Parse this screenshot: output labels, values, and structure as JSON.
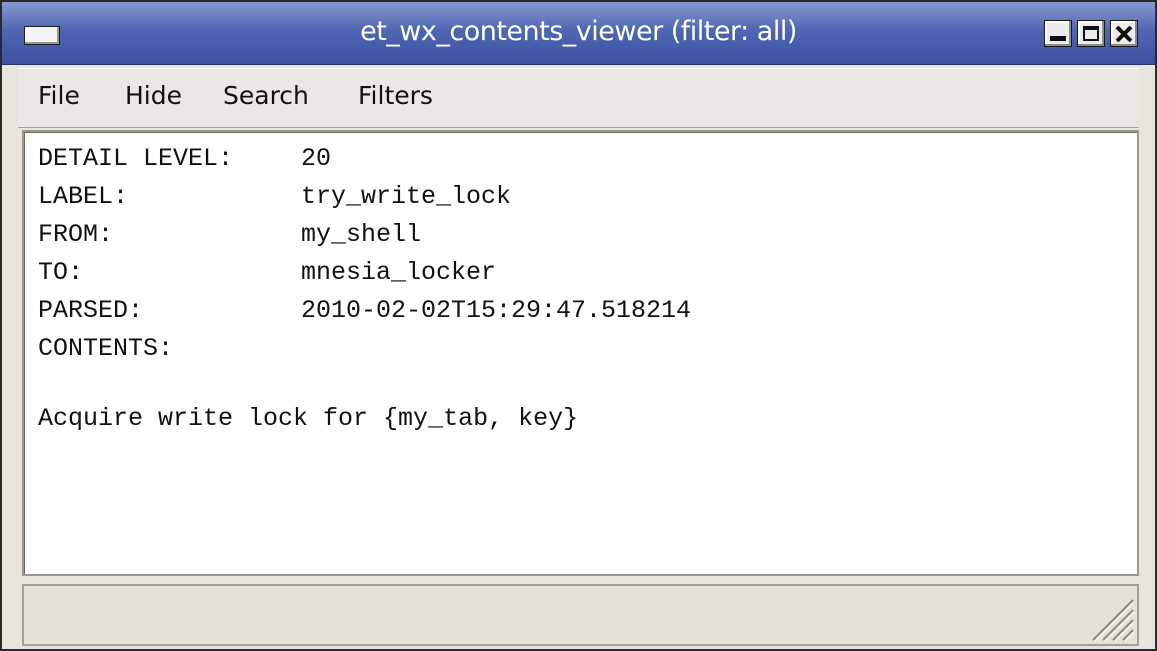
{
  "window": {
    "title": "et_wx_contents_viewer (filter: all)"
  },
  "menu": {
    "file": "File",
    "hide": "Hide",
    "search": "Search",
    "filters": "Filters"
  },
  "content": {
    "detail_level_label": "DETAIL LEVEL:",
    "detail_level_value": "20",
    "label_label": "LABEL:",
    "label_value": "try_write_lock",
    "from_label": "FROM:",
    "from_value": "my_shell",
    "to_label": "TO:",
    "to_value": "mnesia_locker",
    "parsed_label": "PARSED:",
    "parsed_value": "2010-02-02T15:29:47.518214",
    "contents_label": "CONTENTS:",
    "body_text": "Acquire write lock for {my_tab, key}"
  },
  "status": {
    "text": ""
  },
  "icons": {
    "window_menu": "window-menu-icon",
    "minimize": "minimize-icon",
    "maximize": "maximize-icon",
    "close": "close-icon",
    "resize_grip": "resize-grip-icon"
  },
  "colors": {
    "titlebar": "#4e66b3",
    "window_bg": "#e8e4de",
    "content_bg": "#ffffff"
  }
}
